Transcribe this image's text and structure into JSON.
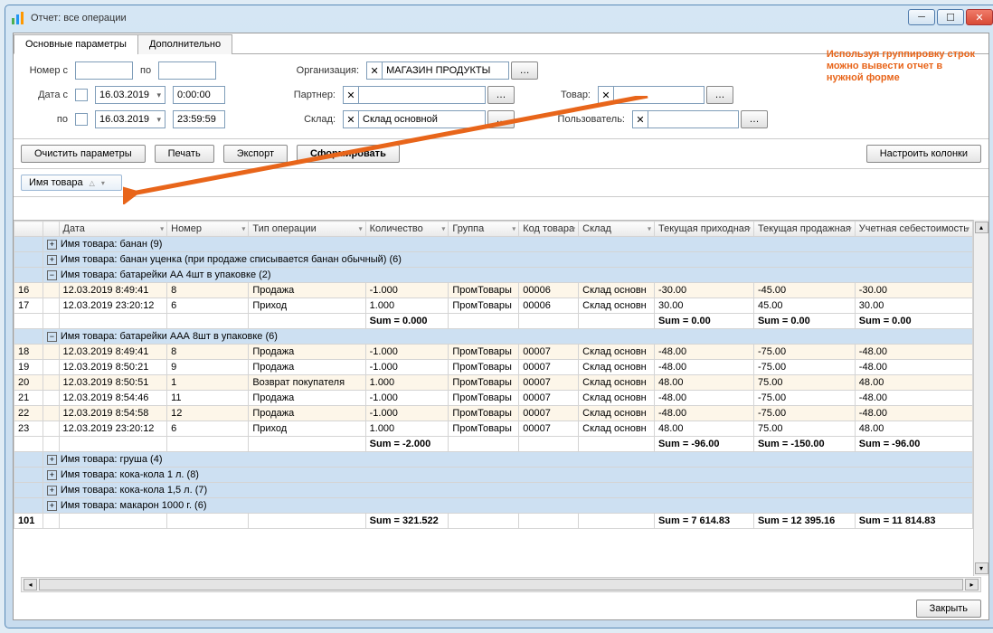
{
  "window": {
    "title": "Отчет: все операции"
  },
  "tabs": {
    "main": "Основные параметры",
    "extra": "Дополнительно"
  },
  "filters": {
    "number_from_label": "Номер с",
    "number_to_label": "по",
    "date_from_label": "Дата с",
    "date_to_label": "по",
    "date1": "16.03.2019",
    "time1": "0:00:00",
    "date2": "16.03.2019",
    "time2": "23:59:59",
    "org_label": "Организация:",
    "org_value": "МАГАЗИН ПРОДУКТЫ",
    "partner_label": "Партнер:",
    "sklad_label": "Склад:",
    "sklad_value": "Склад основной",
    "tovar_label": "Товар:",
    "user_label": "Пользователь:"
  },
  "toolbar": {
    "clear": "Очистить параметры",
    "print": "Печать",
    "export": "Экспорт",
    "build": "Сформировать",
    "columns": "Настроить колонки"
  },
  "grouping": {
    "chip": "Имя товара"
  },
  "columns": {
    "date": "Дата",
    "num": "Номер",
    "op": "Тип операции",
    "qty": "Количество",
    "grp": "Группа",
    "code": "Код товара",
    "skl": "Склад",
    "pin": "Текущая приходная",
    "pout": "Текущая продажная",
    "cost": "Учетная себестоимость"
  },
  "groups": {
    "g1": "Имя товара: банан (9)",
    "g2": "Имя товара: банан уценка (при продаже списывается банан обычный) (6)",
    "g3": "Имя товара: батарейки АА 4шт в упаковке (2)",
    "g4": "Имя товара: батарейки ААА 8шт в упаковке (6)",
    "g5": "Имя товара: груша (4)",
    "g6": "Имя товара: кока-кола 1 л. (8)",
    "g7": "Имя товара: кока-кола 1,5 л. (7)",
    "g8": "Имя товара: макарон 1000 г. (6)"
  },
  "rows": {
    "r16": {
      "n": "16",
      "date": "12.03.2019 8:49:41",
      "num": "8",
      "op": "Продажа",
      "qty": "-1.000",
      "grp": "ПромТовары",
      "code": "00006",
      "skl": "Склад основн",
      "pin": "-30.00",
      "pout": "-45.00",
      "cost": "-30.00"
    },
    "r17": {
      "n": "17",
      "date": "12.03.2019 23:20:12",
      "num": "6",
      "op": "Приход",
      "qty": "1.000",
      "grp": "ПромТовары",
      "code": "00006",
      "skl": "Склад основн",
      "pin": "30.00",
      "pout": "45.00",
      "cost": "30.00"
    },
    "s3": {
      "qty": "Sum = 0.000",
      "pin": "Sum = 0.00",
      "pout": "Sum = 0.00",
      "cost": "Sum = 0.00"
    },
    "r18": {
      "n": "18",
      "date": "12.03.2019 8:49:41",
      "num": "8",
      "op": "Продажа",
      "qty": "-1.000",
      "grp": "ПромТовары",
      "code": "00007",
      "skl": "Склад основн",
      "pin": "-48.00",
      "pout": "-75.00",
      "cost": "-48.00"
    },
    "r19": {
      "n": "19",
      "date": "12.03.2019 8:50:21",
      "num": "9",
      "op": "Продажа",
      "qty": "-1.000",
      "grp": "ПромТовары",
      "code": "00007",
      "skl": "Склад основн",
      "pin": "-48.00",
      "pout": "-75.00",
      "cost": "-48.00"
    },
    "r20": {
      "n": "20",
      "date": "12.03.2019 8:50:51",
      "num": "1",
      "op": "Возврат покупателя",
      "qty": "1.000",
      "grp": "ПромТовары",
      "code": "00007",
      "skl": "Склад основн",
      "pin": "48.00",
      "pout": "75.00",
      "cost": "48.00"
    },
    "r21": {
      "n": "21",
      "date": "12.03.2019 8:54:46",
      "num": "11",
      "op": "Продажа",
      "qty": "-1.000",
      "grp": "ПромТовары",
      "code": "00007",
      "skl": "Склад основн",
      "pin": "-48.00",
      "pout": "-75.00",
      "cost": "-48.00"
    },
    "r22": {
      "n": "22",
      "date": "12.03.2019 8:54:58",
      "num": "12",
      "op": "Продажа",
      "qty": "-1.000",
      "grp": "ПромТовары",
      "code": "00007",
      "skl": "Склад основн",
      "pin": "-48.00",
      "pout": "-75.00",
      "cost": "-48.00"
    },
    "r23": {
      "n": "23",
      "date": "12.03.2019 23:20:12",
      "num": "6",
      "op": "Приход",
      "qty": "1.000",
      "grp": "ПромТовары",
      "code": "00007",
      "skl": "Склад основн",
      "pin": "48.00",
      "pout": "75.00",
      "cost": "48.00"
    },
    "s4": {
      "qty": "Sum = -2.000",
      "pin": "Sum = -96.00",
      "pout": "Sum = -150.00",
      "cost": "Sum = -96.00"
    }
  },
  "total": {
    "n": "101",
    "qty": "Sum = 321.522",
    "pin": "Sum = 7 614.83",
    "pout": "Sum = 12 395.16",
    "cost": "Sum = 11 814.83"
  },
  "footer": {
    "close": "Закрыть"
  },
  "annotation": {
    "l1": "Используя группировку строк",
    "l2": "можно вывести отчет в",
    "l3": "нужной форме"
  }
}
